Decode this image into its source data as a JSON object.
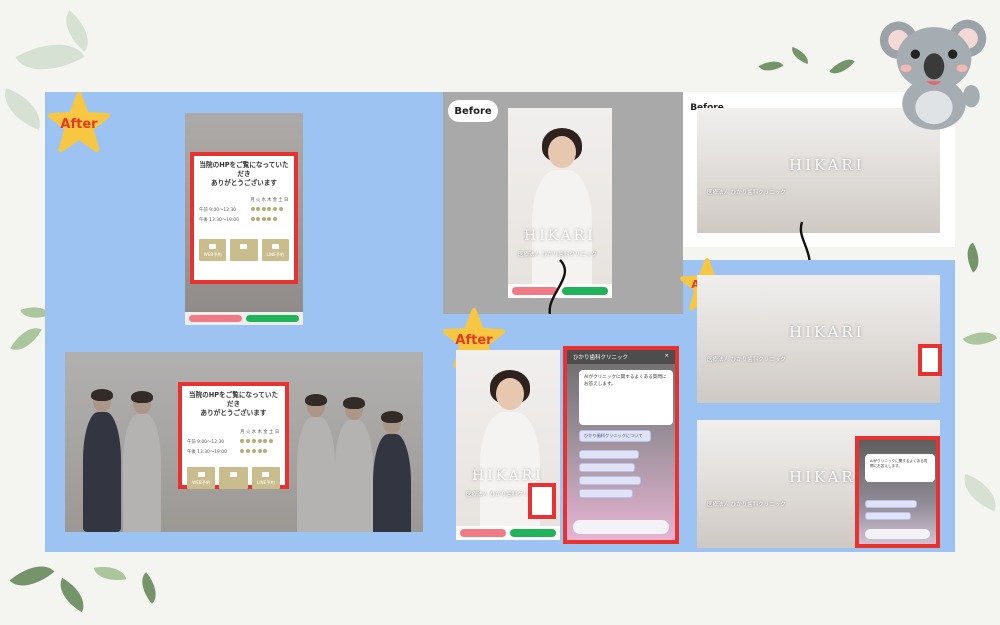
{
  "badges": {
    "after_label": "After",
    "before_label": "Before"
  },
  "colors": {
    "after_star": "#f7c742",
    "after_text": "#e23b1f",
    "highlight": "#e8322f",
    "panel_blue": "#9dc3f3",
    "panel_grey": "#a9a9a9"
  },
  "popup": {
    "title_line1": "当院のHPをご覧になっていただき",
    "title_line2": "ありがとうございます",
    "days": [
      "月",
      "火",
      "水",
      "木",
      "金",
      "土",
      "日"
    ],
    "am_label": "午前 9:00〜12:30",
    "pm_label": "午後 13:30〜19:00",
    "buttons": [
      "WEB予約",
      "LINE予約"
    ]
  },
  "site": {
    "brand": "HIKARI",
    "chat_title": "ひかり歯科クリニック",
    "chat_bubble": "AIがクリニックに関するよくある質問にお答えします。",
    "chat_footer_option": "ひかり歯科クリニックについて"
  },
  "icons": [
    "koala-mascot",
    "star-badge",
    "arrow-curved",
    "leaf-decoration"
  ]
}
